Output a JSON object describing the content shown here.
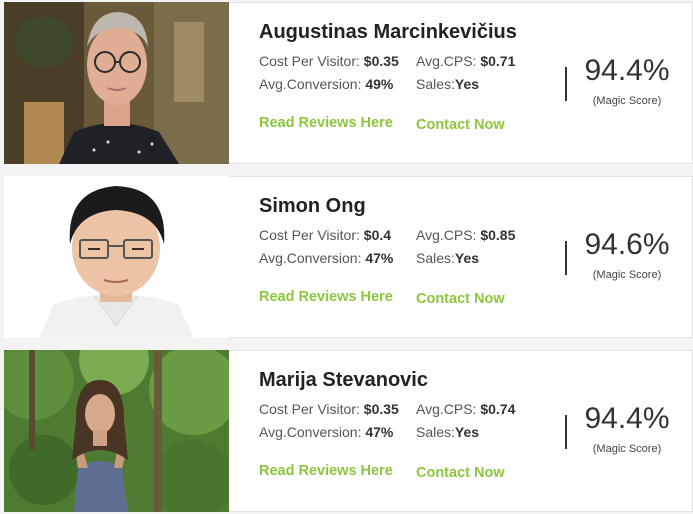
{
  "labels": {
    "cost_per_visitor": "Cost Per Visitor:",
    "avg_cps": "Avg.CPS:",
    "avg_conversion": "Avg.Conversion:",
    "sales": "Sales:",
    "read_reviews": "Read Reviews Here",
    "contact_now": "Contact Now",
    "magic_score": "(Magic Score)"
  },
  "vendors": [
    {
      "name": "Augustinas Marcinkevičius",
      "cost_per_visitor": "$0.35",
      "avg_cps": "$0.71",
      "avg_conversion": "49%",
      "sales": "Yes",
      "magic_score": "94.4%"
    },
    {
      "name": "Simon Ong",
      "cost_per_visitor": "$0.4",
      "avg_cps": "$0.85",
      "avg_conversion": "47%",
      "sales": "Yes",
      "magic_score": "94.6%"
    },
    {
      "name": "Marija Stevanovic",
      "cost_per_visitor": "$0.35",
      "avg_cps": "$0.74",
      "avg_conversion": "47%",
      "sales": "Yes",
      "magic_score": "94.4%"
    }
  ],
  "colors": {
    "link_green": "#8cc63f",
    "text_dark": "#333333",
    "background": "#f3f3f3"
  }
}
